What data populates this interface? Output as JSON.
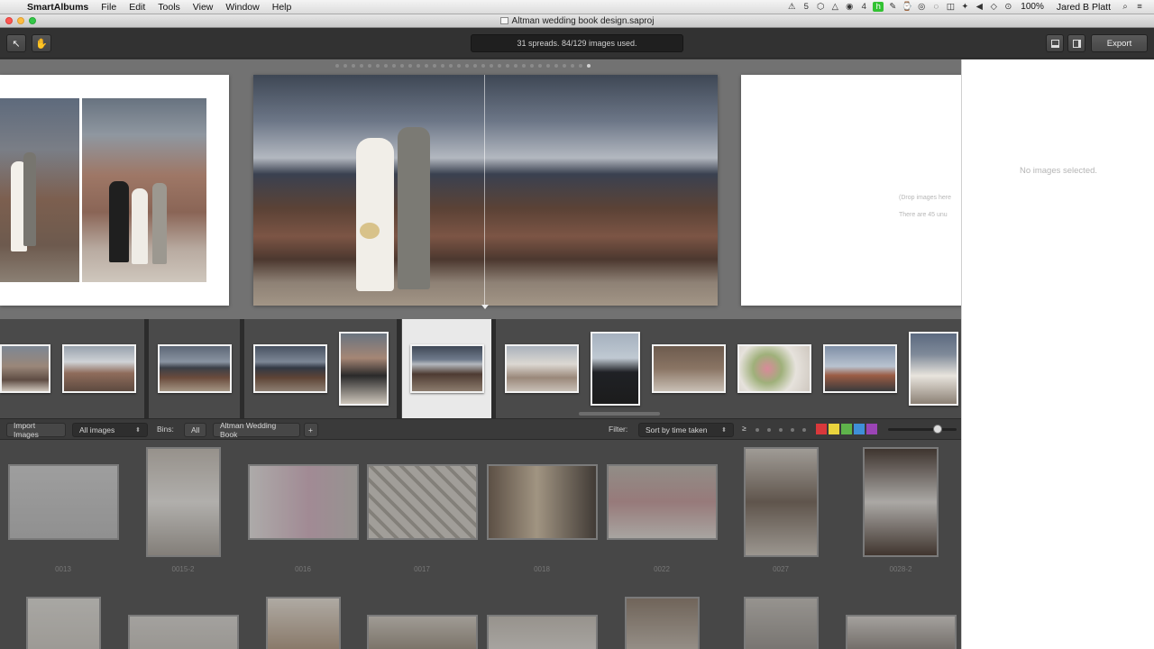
{
  "menubar": {
    "apple": "",
    "app_name": "SmartAlbums",
    "menus": [
      "File",
      "Edit",
      "Tools",
      "View",
      "Window",
      "Help"
    ],
    "tray": [
      "⚠",
      "5",
      "⬡",
      "△",
      "◉",
      "4",
      "h",
      "✎",
      "⌚",
      "◎",
      "◌",
      "◫",
      "✦",
      "◀",
      "◇",
      "⊙"
    ],
    "battery": "100%",
    "user": "Jared B Platt",
    "search": "⌕",
    "list": "≡"
  },
  "window": {
    "title": "Altman wedding book design.saproj"
  },
  "toolbar": {
    "status": "31 spreads. 84/129 images used.",
    "export_label": "Export",
    "select_tool": "↖",
    "hand_tool": "✋"
  },
  "spreads": {
    "right_hint_1": "(Drop images here",
    "right_hint_2": "There are 45 unu"
  },
  "browser_bar": {
    "import_label": "Import Images",
    "source_select": "All images",
    "bins_label": "Bins:",
    "bin_all": "All",
    "bin_book": "Altman Wedding Book",
    "add_bin": "+",
    "filter_label": "Filter:",
    "sort_select": "Sort by time taken",
    "rating_op": "≥",
    "select_arrows": "⬍",
    "colors": [
      "#d9383b",
      "#e9d33d",
      "#5fb34b",
      "#3f8fd8",
      "#9b44b5"
    ]
  },
  "browser": {
    "row1": [
      "0013",
      "0015-2",
      "0016",
      "0017",
      "0018",
      "0022",
      "0027",
      "0028-2"
    ],
    "row2": [
      "",
      "",
      "",
      "",
      "",
      "",
      "",
      ""
    ]
  },
  "inspector": {
    "empty_text": "No images selected."
  }
}
